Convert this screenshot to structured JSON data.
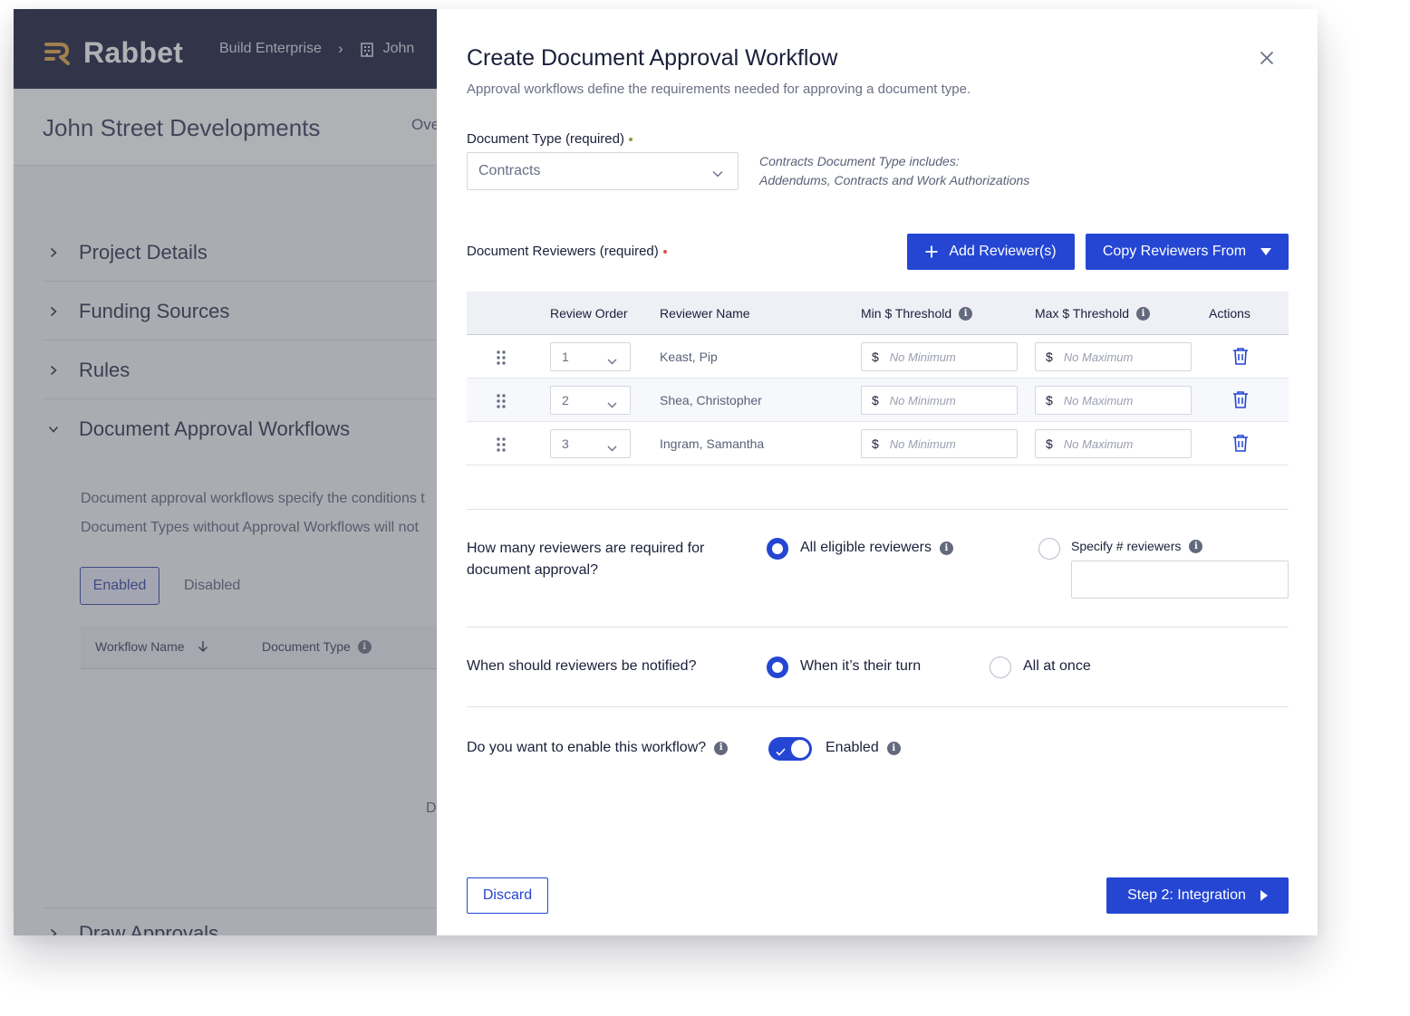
{
  "app": {
    "brand": "Rabbet",
    "brand_color": "#e0a23a",
    "breadcrumbs": [
      "Build Enterprise",
      "John"
    ],
    "project_title": "John Street Developments",
    "overview_tab": "Ove",
    "sections": [
      {
        "label": "Project Details",
        "expanded": false
      },
      {
        "label": "Funding Sources",
        "expanded": false
      },
      {
        "label": "Rules",
        "expanded": false
      },
      {
        "label": "Document Approval Workflows",
        "expanded": true
      }
    ],
    "workflow_desc_1": "Document approval workflows specify the conditions t",
    "workflow_desc_2": "Document Types without Approval Workflows will not",
    "status_tabs": {
      "enabled": "Enabled",
      "disabled": "Disabled"
    },
    "workflow_table_headers": {
      "name": "Workflow Name",
      "type": "Document Type"
    },
    "partial_text": "D",
    "draw_approvals": "Draw Approvals"
  },
  "modal": {
    "title": "Create Document Approval Workflow",
    "subtitle": "Approval workflows define the requirements needed for approving a document type.",
    "document_type": {
      "label": "Document Type (required)",
      "required_color": "#7fa33c",
      "value": "Contracts",
      "note_line1": "Contracts Document Type includes:",
      "note_line2": "Addendums, Contracts and Work Authorizations"
    },
    "reviewers": {
      "label": "Document Reviewers (required)",
      "required_color": "#d9534f",
      "add_button": "Add Reviewer(s)",
      "copy_button": "Copy Reviewers From",
      "columns": {
        "order": "Review Order",
        "name": "Reviewer Name",
        "min": "Min $ Threshold",
        "max": "Max $ Threshold",
        "actions": "Actions"
      },
      "rows": [
        {
          "order": "1",
          "name": "Keast, Pip",
          "currency": "$",
          "min_placeholder": "No Minimum",
          "max_placeholder": "No Maximum"
        },
        {
          "order": "2",
          "name": "Shea, Christopher",
          "currency": "$",
          "min_placeholder": "No Minimum",
          "max_placeholder": "No Maximum"
        },
        {
          "order": "3",
          "name": "Ingram, Samantha",
          "currency": "$",
          "min_placeholder": "No Minimum",
          "max_placeholder": "No Maximum"
        }
      ]
    },
    "required_count": {
      "question_line1": "How many reviewers are required for",
      "question_line2": "document approval?",
      "option_all": "All eligible reviewers",
      "option_specify": "Specify # reviewers",
      "selected": "all",
      "specify_value": ""
    },
    "notify": {
      "question": "When should reviewers be notified?",
      "option_turn": "When it’s their turn",
      "option_all": "All at once",
      "selected": "turn"
    },
    "enable": {
      "question": "Do you want to enable this workflow?",
      "toggle_label": "Enabled",
      "value": true
    },
    "discard_button": "Discard",
    "next_button": "Step 2: Integration",
    "accent_color": "#2446d3"
  }
}
